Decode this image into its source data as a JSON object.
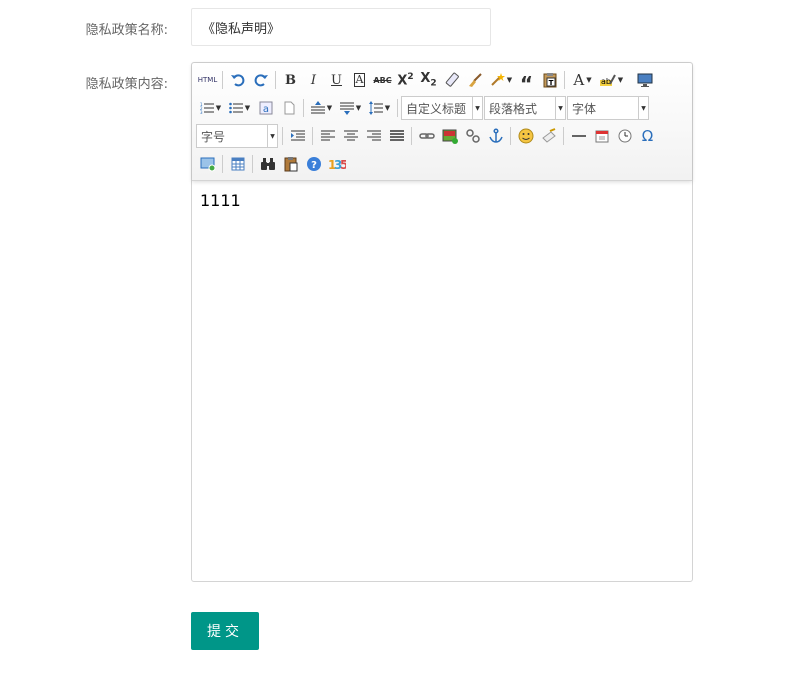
{
  "form": {
    "name_label": "隐私政策名称:",
    "name_value": "《隐私声明》",
    "content_label": "隐私政策内容:",
    "submit_label": "提交"
  },
  "editor": {
    "content": "1111",
    "toolbar": {
      "html_label": "HTML",
      "bold": "B",
      "italic": "I",
      "underline": "U",
      "boxed_a": "A",
      "strike": "ABC",
      "font_color": "A",
      "custom_title": "自定义标题",
      "paragraph_format": "段落格式",
      "font_family": "字体",
      "font_size": "字号",
      "special_char": "Ω"
    }
  },
  "colors": {
    "submit_bg": "#009688",
    "input_border": "#e6e6e6",
    "editor_border": "#d4d4d4",
    "label_color": "#666666"
  }
}
